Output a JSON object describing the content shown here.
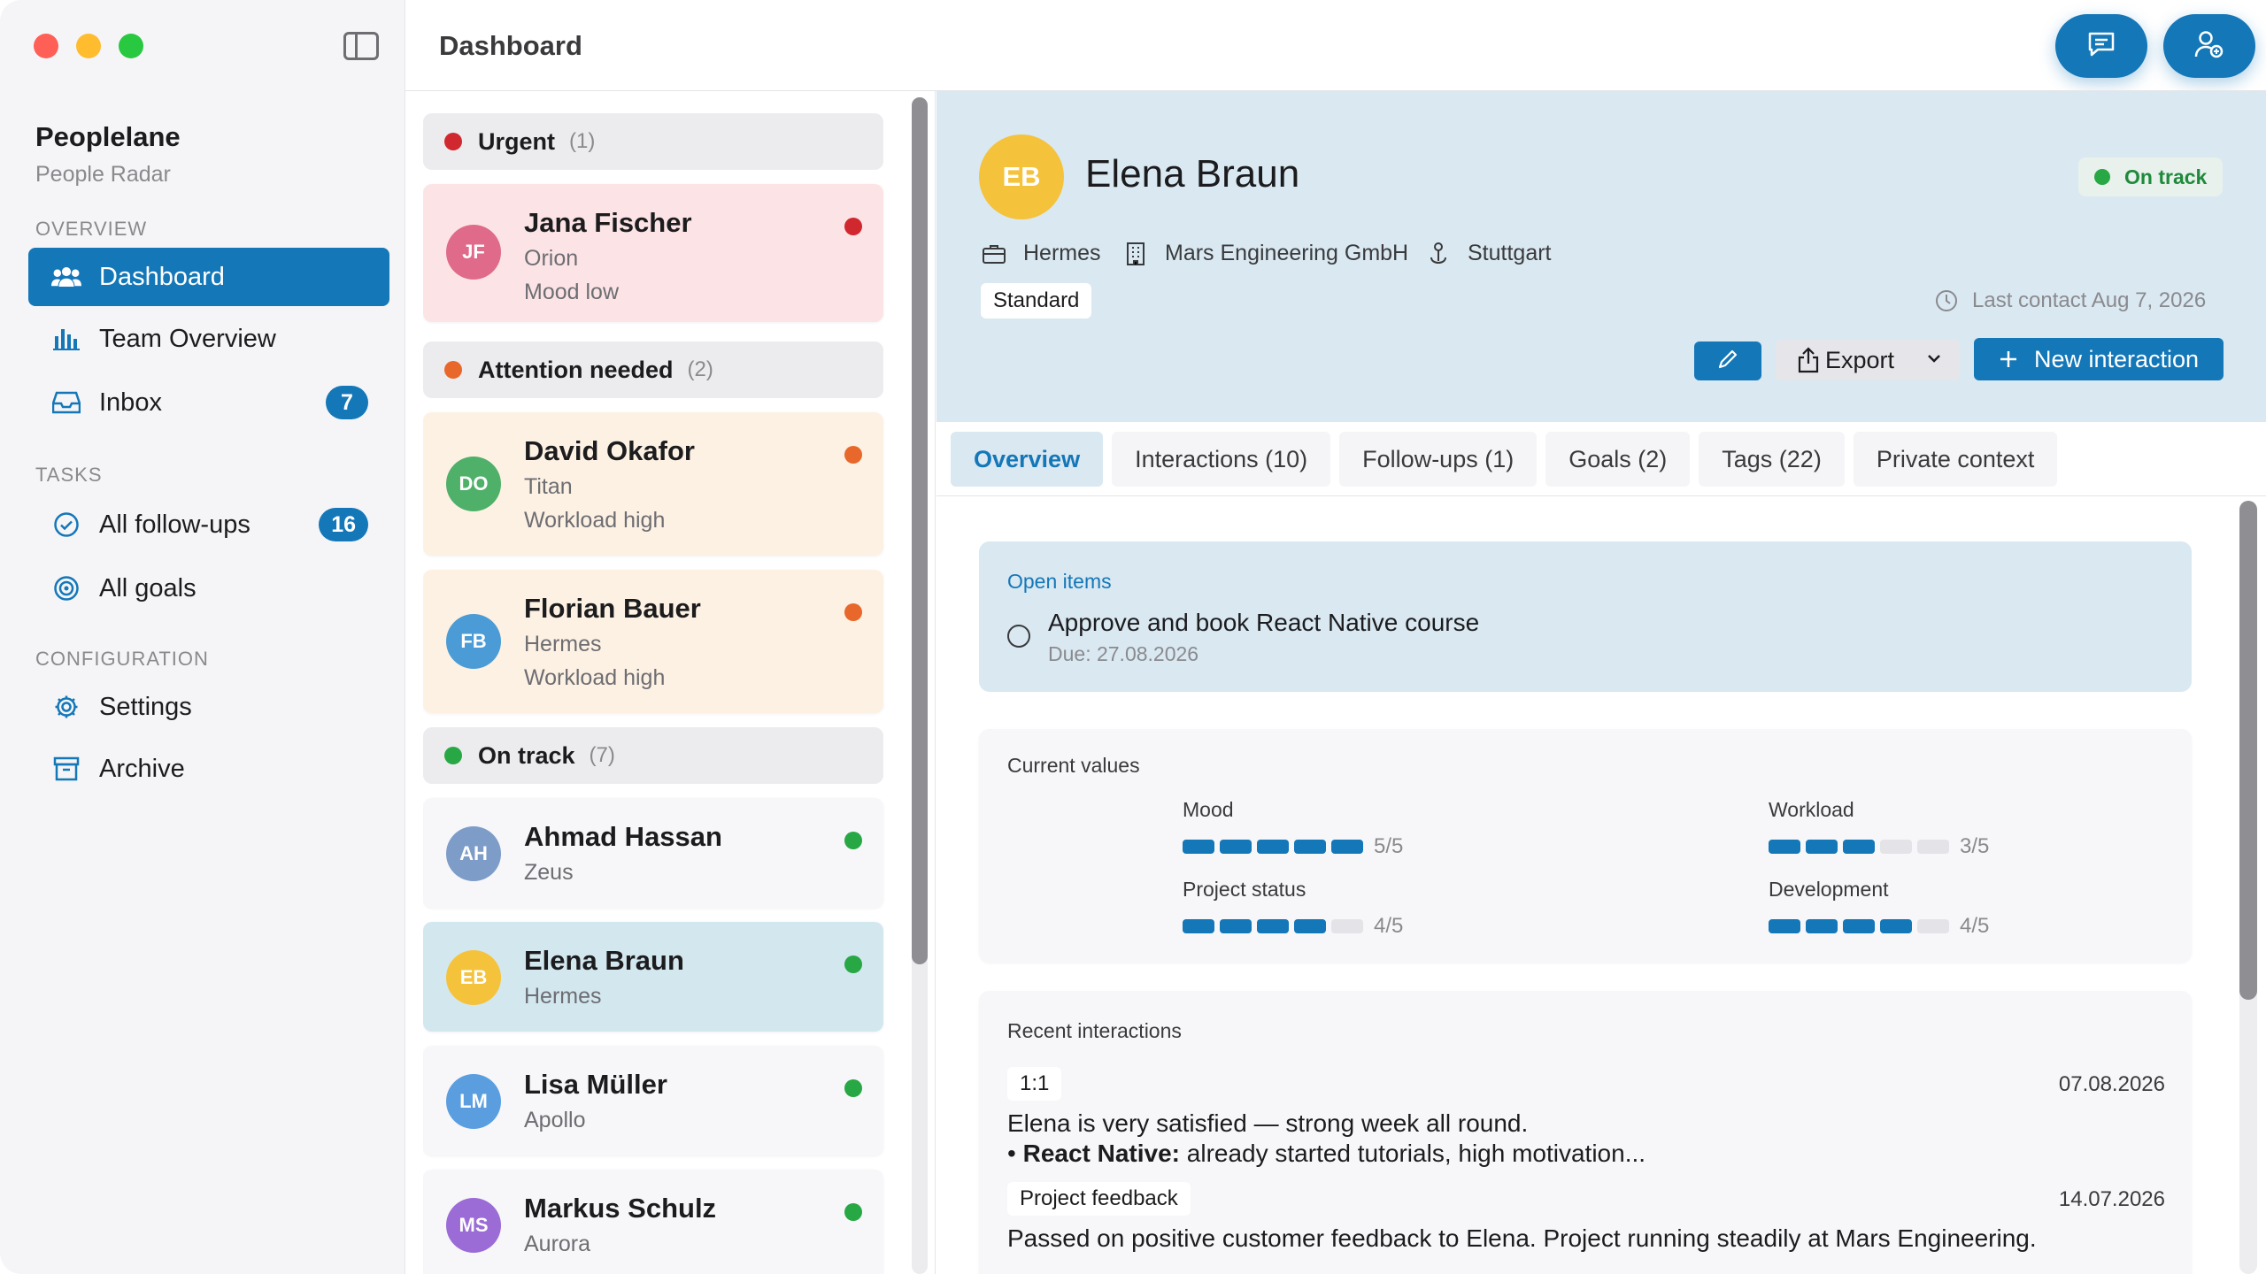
{
  "header": {
    "title": "Dashboard"
  },
  "sidebar": {
    "app_name": "Peoplelane",
    "app_subtitle": "People Radar",
    "sections": {
      "overview": "OVERVIEW",
      "tasks": "TASKS",
      "configuration": "CONFIGURATION"
    },
    "items": {
      "dashboard": "Dashboard",
      "team_overview": "Team Overview",
      "inbox": "Inbox",
      "inbox_badge": "7",
      "all_followups": "All follow-ups",
      "followups_badge": "16",
      "all_goals": "All goals",
      "settings": "Settings",
      "archive": "Archive"
    }
  },
  "list": {
    "groups": {
      "urgent": {
        "label": "Urgent",
        "count": "(1)",
        "color": "#d0282e"
      },
      "attention": {
        "label": "Attention needed",
        "count": "(2)",
        "color": "#e8672a"
      },
      "ontrack": {
        "label": "On track",
        "count": "(7)",
        "color": "#28a745"
      }
    },
    "people": [
      {
        "initials": "JF",
        "name": "Jana Fischer",
        "team": "Orion",
        "note": "Mood low",
        "avatar_color": "#e06a8a"
      },
      {
        "initials": "DO",
        "name": "David Okafor",
        "team": "Titan",
        "note": "Workload high",
        "avatar_color": "#4fb06a"
      },
      {
        "initials": "FB",
        "name": "Florian Bauer",
        "team": "Hermes",
        "note": "Workload high",
        "avatar_color": "#4a9bd6"
      },
      {
        "initials": "AH",
        "name": "Ahmad Hassan",
        "team": "Zeus",
        "avatar_color": "#7d9cc8"
      },
      {
        "initials": "EB",
        "name": "Elena Braun",
        "team": "Hermes",
        "avatar_color": "#f5c23b"
      },
      {
        "initials": "LM",
        "name": "Lisa Müller",
        "team": "Apollo",
        "avatar_color": "#5a9ee0"
      },
      {
        "initials": "MS",
        "name": "Markus Schulz",
        "team": "Aurora",
        "avatar_color": "#9b6bd6"
      }
    ]
  },
  "detail": {
    "initials": "EB",
    "name": "Elena Braun",
    "status": "On track",
    "team": "Hermes",
    "company": "Mars Engineering GmbH",
    "location": "Stuttgart",
    "tag": "Standard",
    "last_contact": "Last contact Aug 7, 2026",
    "export_label": "Export",
    "new_interaction_label": "New interaction",
    "tabs": [
      "Overview",
      "Interactions (10)",
      "Follow-ups (1)",
      "Goals (2)",
      "Tags (22)",
      "Private context"
    ],
    "open_items": {
      "label": "Open items",
      "item": "Approve and book React Native course",
      "due": "Due: 27.08.2026"
    },
    "current_values": {
      "title": "Current values",
      "metrics": [
        {
          "label": "Mood",
          "value": 5,
          "max": 5,
          "text": "5/5"
        },
        {
          "label": "Workload",
          "value": 3,
          "max": 5,
          "text": "3/5"
        },
        {
          "label": "Project status",
          "value": 4,
          "max": 5,
          "text": "4/5"
        },
        {
          "label": "Development",
          "value": 4,
          "max": 5,
          "text": "4/5"
        }
      ]
    },
    "recent": {
      "title": "Recent interactions",
      "items": [
        {
          "tag": "1:1",
          "date": "07.08.2026",
          "line1": "Elena is very satisfied — strong week all round.",
          "bullet_bold": "React Native:",
          "bullet_rest": " already started tutorials, high motivation..."
        },
        {
          "tag": "Project feedback",
          "date": "14.07.2026",
          "line1": "Passed on positive customer feedback to Elena. Project running steadily at Mars Engineering."
        }
      ]
    }
  }
}
